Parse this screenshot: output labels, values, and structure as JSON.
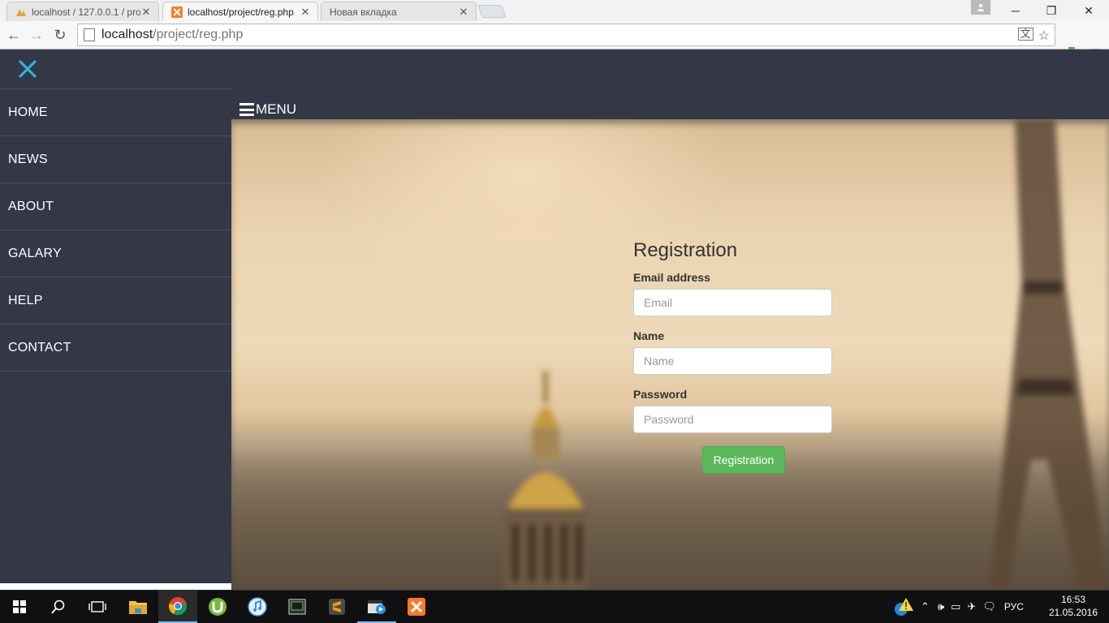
{
  "browser": {
    "tabs": [
      {
        "title": "localhost / 127.0.0.1 / proj",
        "icon": "phpmyadmin-icon",
        "active": false
      },
      {
        "title": "localhost/project/reg.php",
        "icon": "xampp-icon",
        "active": true
      },
      {
        "title": "Новая вкладка",
        "icon": "",
        "active": false
      }
    ],
    "url_host": "localhost",
    "url_path": "/project/reg.php"
  },
  "sidebar": {
    "items": [
      {
        "label": "HOME"
      },
      {
        "label": "NEWS"
      },
      {
        "label": "ABOUT"
      },
      {
        "label": "GALARY"
      },
      {
        "label": "HELP"
      },
      {
        "label": "CONTACT"
      }
    ]
  },
  "topbar": {
    "menu_label": "MENU"
  },
  "form": {
    "title": "Registration",
    "email_label": "Email address",
    "email_placeholder": "Email",
    "name_label": "Name",
    "name_placeholder": "Name",
    "password_label": "Password",
    "password_placeholder": "Password",
    "submit_label": "Registration"
  },
  "taskbar": {
    "lang": "РУС",
    "time": "16:53",
    "date": "21.05.2016"
  },
  "colors": {
    "accent": "#29b6d8",
    "sidebar_bg": "#343746",
    "button_green": "#5cb85c"
  }
}
